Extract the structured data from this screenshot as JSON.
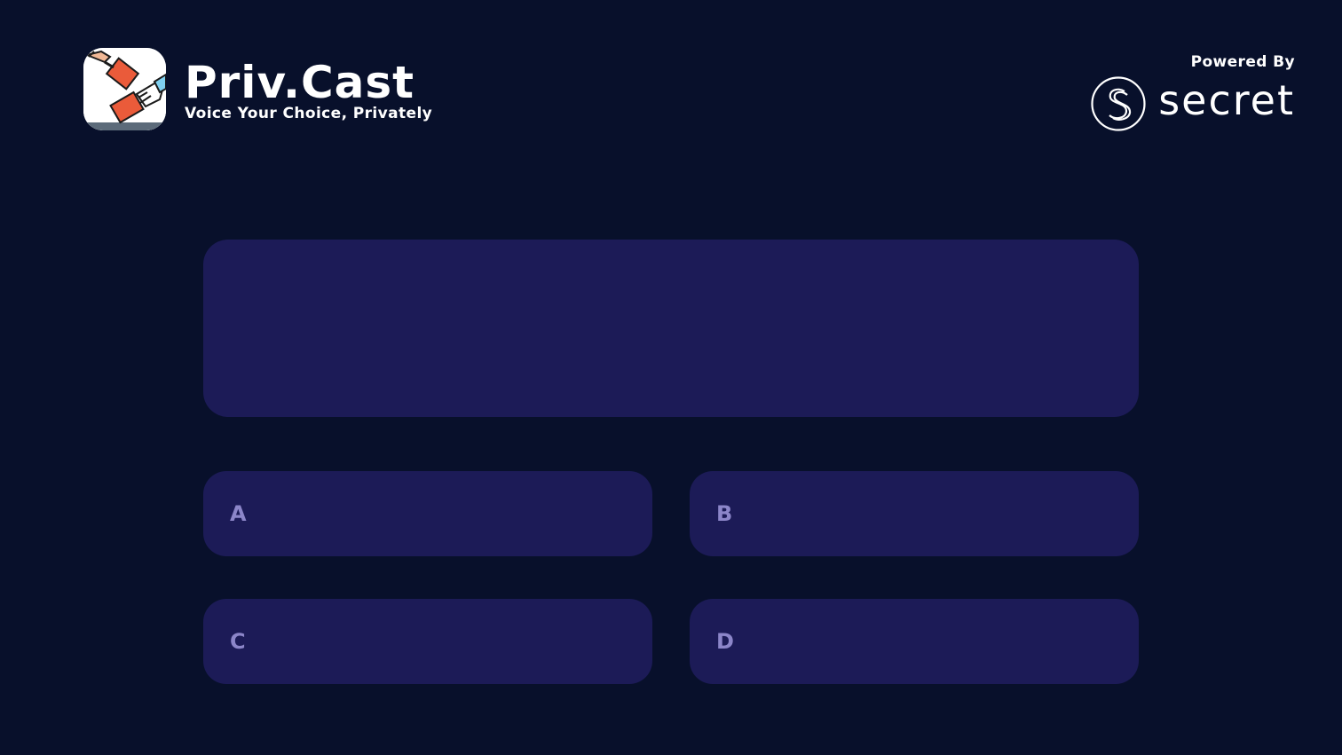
{
  "brand": {
    "title": "Priv.Cast",
    "tagline": "Voice Your Choice, Privately",
    "logo_icon": "ballot-hands-icon"
  },
  "powered_by": {
    "label": "Powered By",
    "name": "secret",
    "icon": "secret-network-icon"
  },
  "question": {
    "text": ""
  },
  "options": [
    {
      "letter": "A",
      "text": ""
    },
    {
      "letter": "B",
      "text": ""
    },
    {
      "letter": "C",
      "text": ""
    },
    {
      "letter": "D",
      "text": ""
    }
  ],
  "colors": {
    "background": "#08102b",
    "card": "#1c1b57",
    "option_letter": "#8c86c9",
    "text": "#ffffff"
  }
}
